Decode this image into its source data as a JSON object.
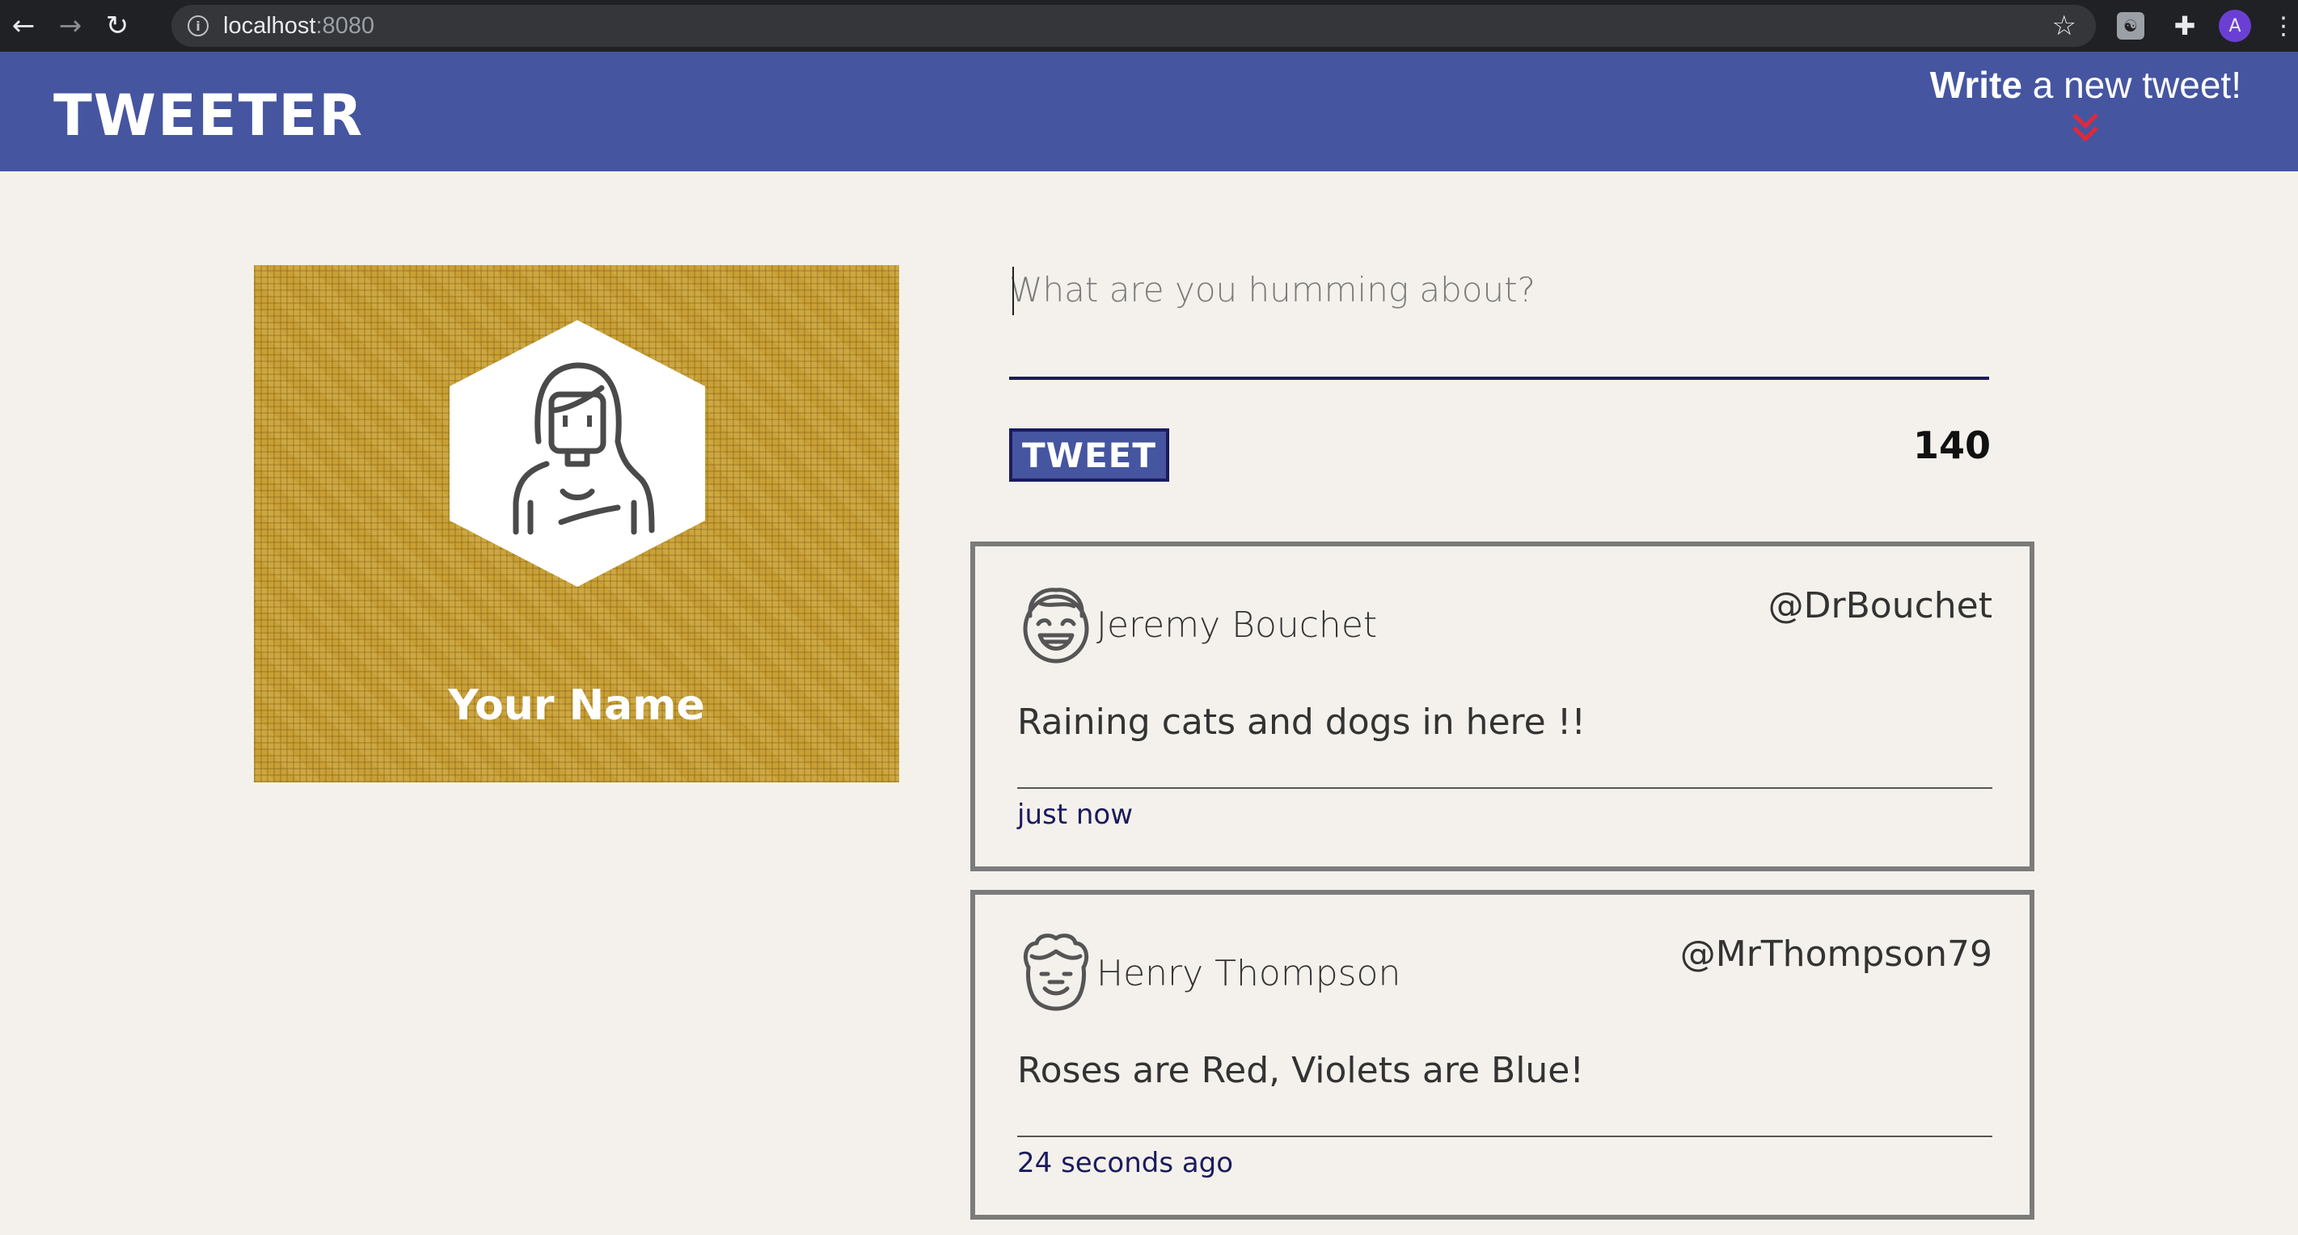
{
  "browser": {
    "url_host": "localhost",
    "url_port": ":8080",
    "ext_label": "☯",
    "profile_initial": "A"
  },
  "header": {
    "brand": "TWEETER",
    "compose_bold": "Write",
    "compose_rest": " a new tweet!",
    "chevron_icon": "double-chevron-down-icon"
  },
  "profile": {
    "name": "Your Name"
  },
  "composer": {
    "placeholder": "What are you humming about?",
    "tweet_label": "TWEET",
    "counter": "140"
  },
  "tweets": [
    {
      "name": "Jeremy Bouchet",
      "handle": "@DrBouchet",
      "text": "Raining cats and dogs in here !!",
      "time": "just now"
    },
    {
      "name": "Henry Thompson",
      "handle": "@MrThompson79",
      "text": "Roses are Red, Violets are Blue!",
      "time": "24 seconds ago"
    }
  ],
  "colors": {
    "header_bg": "#4555a0",
    "page_bg": "#f4f1ec",
    "accent_red": "#e0293a",
    "navy": "#1b1b5e",
    "profile_bg": "#c9a036"
  }
}
